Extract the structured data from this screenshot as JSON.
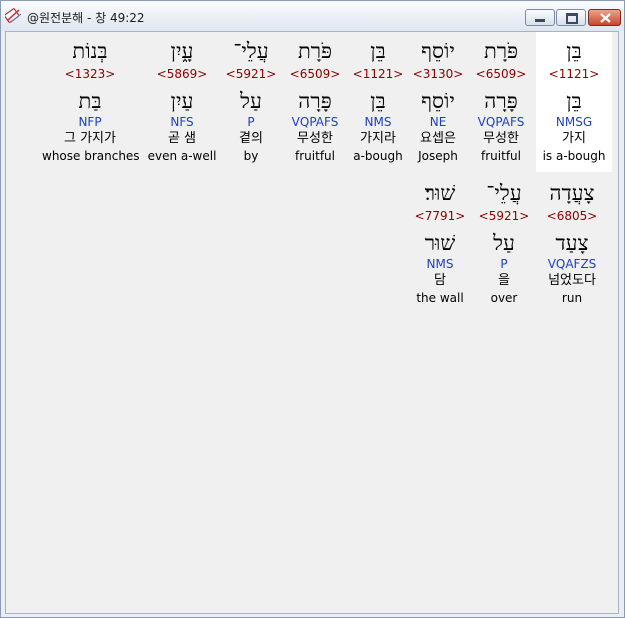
{
  "window": {
    "title": "@원전분해 - 창 49:22"
  },
  "rows": [
    [
      {
        "hebrew": "בְּנוֹת",
        "strong": "<1323>",
        "root": "בַּת",
        "morph": "NFP",
        "korean": "그 가지가",
        "english": "whose branches"
      },
      {
        "hebrew": "עָ֑יִן",
        "strong": "<5869>",
        "root": "עַיִן",
        "morph": "NFS",
        "korean": "곧 샘",
        "english": "even a-well"
      },
      {
        "hebrew": "עֲלֵי־",
        "strong": "<5921>",
        "root": "עַל",
        "morph": "P",
        "korean": "곁의",
        "english": "by"
      },
      {
        "hebrew": "פֹּרָת",
        "strong": "<6509>",
        "root": "פָּרָה",
        "morph": "VQPAFS",
        "korean": "무성한",
        "english": "fruitful"
      },
      {
        "hebrew": "בֵּן",
        "strong": "<1121>",
        "root": "בֵּן",
        "morph": "NMS",
        "korean": "가지라",
        "english": "a-bough"
      },
      {
        "hebrew": "יוֹסֵף",
        "strong": "<3130>",
        "root": "יוֹסֵף",
        "morph": "NE",
        "korean": "요셉은",
        "english": "Joseph"
      },
      {
        "hebrew": "פֹּרָת",
        "strong": "<6509>",
        "root": "פָּרָה",
        "morph": "VQPAFS",
        "korean": "무성한",
        "english": "fruitful"
      },
      {
        "hebrew": "בֵּן",
        "strong": "<1121>",
        "root": "בֵּן",
        "morph": "NMSG",
        "korean": "가지",
        "english": "is a-bough",
        "selected": true
      }
    ],
    [
      {
        "hebrew": "שׁוּר׃",
        "strong": "<7791>",
        "root": "שׁוּר",
        "morph": "NMS",
        "korean": "담",
        "english": "the wall"
      },
      {
        "hebrew": "עֲלֵי־",
        "strong": "<5921>",
        "root": "עַל",
        "morph": "P",
        "korean": "을",
        "english": "over"
      },
      {
        "hebrew": "צָעֲדָה",
        "strong": "<6805>",
        "root": "צָעַד",
        "morph": "VQAFZS",
        "korean": "넘었도다",
        "english": "run"
      }
    ]
  ]
}
